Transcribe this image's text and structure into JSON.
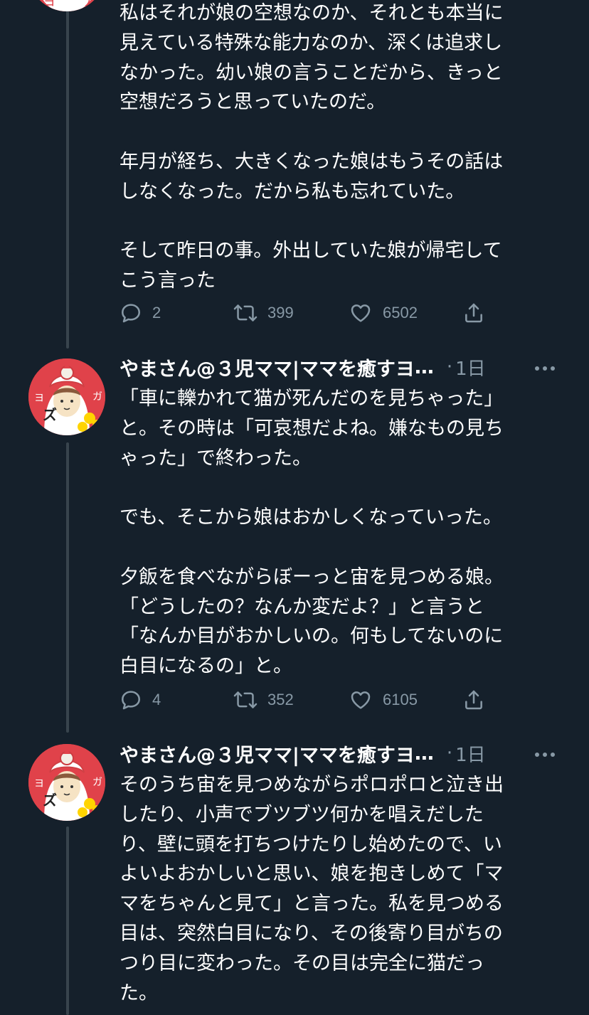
{
  "tweets": [
    {
      "text": "私はそれが娘の空想なのか、それとも本当に\n見えている特殊な能力なのか、深くは追求し\nなかった。幼い娘の言うことだから、きっと\n空想だろうと思っていたのだ。\n\n年月が経ち、大きくなった娘はもうその話は\nしなくなった。だから私も忘れていた。\n\nそして昨日の事。外出していた娘が帰宅して\nこう言った",
      "replies": "2",
      "retweets": "399",
      "likes": "6502"
    },
    {
      "author": "やまさん@３児ママ|ママを癒すヨ",
      "ellipsis": "…",
      "dot": "·",
      "time": "1日",
      "text": "「車に轢かれて猫が死んだのを見ちゃった」\nと。その時は「可哀想だよね。嫌なもの見ち\nゃった」で終わった。\n\nでも、そこから娘はおかしくなっていった。\n\n夕飯を食べながらぼーっと宙を見つめる娘。\n「どうしたの？なんか変だよ？」と言うと\n「なんか目がおかしいの。何もしてないのに\n白目になるの」と。",
      "replies": "4",
      "retweets": "352",
      "likes": "6105"
    },
    {
      "author": "やまさん@３児ママ|ママを癒すヨ",
      "ellipsis": "…",
      "dot": "·",
      "time": "1日",
      "text": "そのうち宙を見つめながらポロポロと泣き出\nしたり、小声でブツブツ何かを唱えだした\nり、壁に頭を打ちつけたりし始めたので、い\nよいよおかしいと思い、娘を抱きしめて「マ\nマをちゃんと見て」と言った。私を見つめる\n目は、突然白目になり、その後寄り目がちの\nつり目に変わった。その目は完全に猫だっ\nた。"
    }
  ],
  "icons": {
    "reply": "reply-bubble-icon",
    "retweet": "retweet-arrows-icon",
    "like": "heart-icon",
    "share": "share-upload-icon",
    "more": "more-dots-icon"
  },
  "colors": {
    "background": "#15202b",
    "text": "#ffffff",
    "secondary": "#8899a6",
    "thread_line": "#38444d",
    "avatar_bg": "#e0424a"
  }
}
